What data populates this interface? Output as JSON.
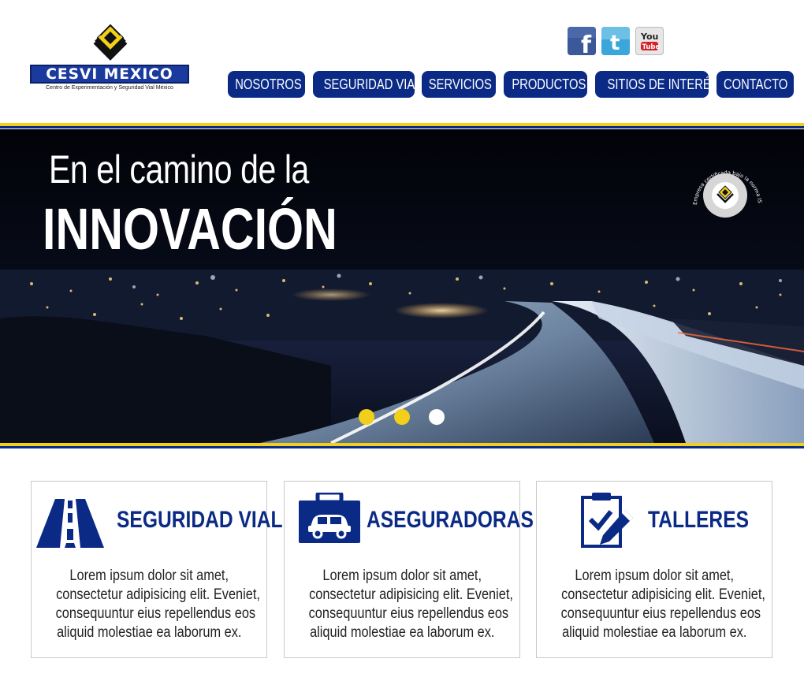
{
  "brand": {
    "name": "CESVI MEXICO",
    "tagline": "Centro de Experimentación y Seguridad Vial México",
    "colors": {
      "navy": "#0b2a85",
      "yellow": "#f2cf1a"
    }
  },
  "social": [
    {
      "name": "facebook-icon",
      "label": "f"
    },
    {
      "name": "twitter-icon",
      "label": "t"
    },
    {
      "name": "youtube-icon",
      "label_top": "You",
      "label_bottom": "Tube"
    }
  ],
  "nav": [
    "NOSOTROS",
    "SEGURIDAD VIAL",
    "SERVICIOS",
    "PRODUCTOS",
    "SITIOS DE INTERÉS",
    "CONTACTO"
  ],
  "hero": {
    "line1": "En el camino de la",
    "line2": "INNOVACIÓN",
    "seal_text": "Empresa certificada bajo la norma ISO 9001:2008",
    "seal_inner": "Calidad Cesvi México",
    "slider": {
      "count": 3,
      "active": 3
    }
  },
  "cards": [
    {
      "icon": "road-icon",
      "title": "SEGURIDAD VIAL",
      "body": [
        "Lorem ipsum dolor sit amet,",
        "consectetur adipisicing elit. Eveniet,",
        "consequuntur eius repellendus eos",
        "aliquid molestiae ea laborum ex."
      ]
    },
    {
      "icon": "insurance-car-icon",
      "title": "ASEGURADORAS",
      "body": [
        "Lorem ipsum dolor sit amet,",
        "consectetur adipisicing elit. Eveniet,",
        "consequuntur eius repellendus eos",
        "aliquid molestiae ea laborum ex."
      ]
    },
    {
      "icon": "clipboard-check-icon",
      "title": "TALLERES",
      "body": [
        "Lorem ipsum dolor sit amet,",
        "consectetur adipisicing elit. Eveniet,",
        "consequuntur eius repellendus eos",
        "aliquid molestiae ea laborum ex."
      ]
    }
  ]
}
